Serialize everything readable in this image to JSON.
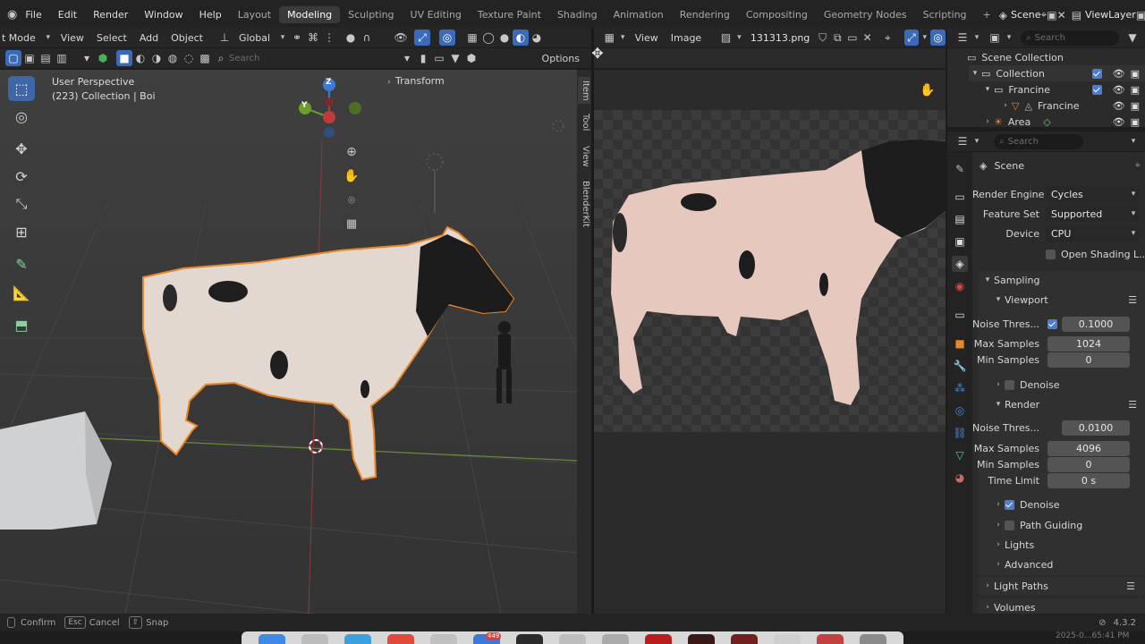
{
  "topbar": {
    "menus": [
      "File",
      "Edit",
      "Render",
      "Window",
      "Help"
    ],
    "workspaces": [
      "Layout",
      "Modeling",
      "Sculpting",
      "UV Editing",
      "Texture Paint",
      "Shading",
      "Animation",
      "Rendering",
      "Compositing",
      "Geometry Nodes",
      "Scripting"
    ],
    "active_workspace": "Modeling",
    "add_tab": "+",
    "scene_name": "Scene",
    "view_layer": "ViewLayer"
  },
  "viewport_header": {
    "mode": "t Mode",
    "menus": [
      "View",
      "Select",
      "Add",
      "Object"
    ],
    "orientation": "Global",
    "search_placeholder": "Search",
    "options_label": "Options"
  },
  "viewport": {
    "perspective": "User Perspective",
    "collection_info": "(223) Collection | Boi",
    "transform_panel": "Transform",
    "side_tabs": [
      "Item",
      "Tool",
      "View",
      "BlenderKit"
    ],
    "gizmo_axes": {
      "x": "X",
      "y": "Y",
      "z": "Z"
    }
  },
  "image_header": {
    "menus": [
      "View",
      "Image"
    ],
    "image_name": "131313.png"
  },
  "outliner": {
    "search_placeholder": "Search",
    "items": [
      {
        "label": "Scene Collection",
        "depth": 0
      },
      {
        "label": "Collection",
        "depth": 1
      },
      {
        "label": "Francine",
        "depth": 2
      },
      {
        "label": "Francine",
        "depth": 3
      },
      {
        "label": "Area",
        "depth": 2
      }
    ]
  },
  "properties": {
    "search_placeholder": "Search",
    "context": "Scene",
    "render_engine_label": "Render Engine",
    "render_engine": "Cycles",
    "feature_set_label": "Feature Set",
    "feature_set": "Supported",
    "device_label": "Device",
    "device": "CPU",
    "open_shading_label": "Open Shading L...",
    "sampling": {
      "title": "Sampling",
      "viewport_title": "Viewport",
      "viewport_noise_label": "Noise Thres...",
      "viewport_noise": "0.1000",
      "viewport_max_label": "Max Samples",
      "viewport_max": "1024",
      "viewport_min_label": "Min Samples",
      "viewport_min": "0",
      "viewport_denoise": "Denoise",
      "render_title": "Render",
      "render_noise_label": "Noise Thres...",
      "render_noise": "0.0100",
      "render_max_label": "Max Samples",
      "render_max": "4096",
      "render_min_label": "Min Samples",
      "render_min": "0",
      "time_limit_label": "Time Limit",
      "time_limit": "0 s",
      "render_denoise": "Denoise",
      "path_guiding": "Path Guiding",
      "lights": "Lights",
      "advanced": "Advanced"
    },
    "light_paths": "Light Paths",
    "volumes": "Volumes"
  },
  "statusbar": {
    "confirm": "Confirm",
    "esc_key": "Esc",
    "cancel": "Cancel",
    "snap": "Snap",
    "version": "4.3.2",
    "clock": "2025-0...65:41 PM"
  },
  "dock": {
    "badge": "449"
  },
  "colors": {
    "accent": "#3f66a8",
    "selection_outline": "#e8862a",
    "panel_bg": "#2b2b2b",
    "viewport_bg": "#393939"
  }
}
